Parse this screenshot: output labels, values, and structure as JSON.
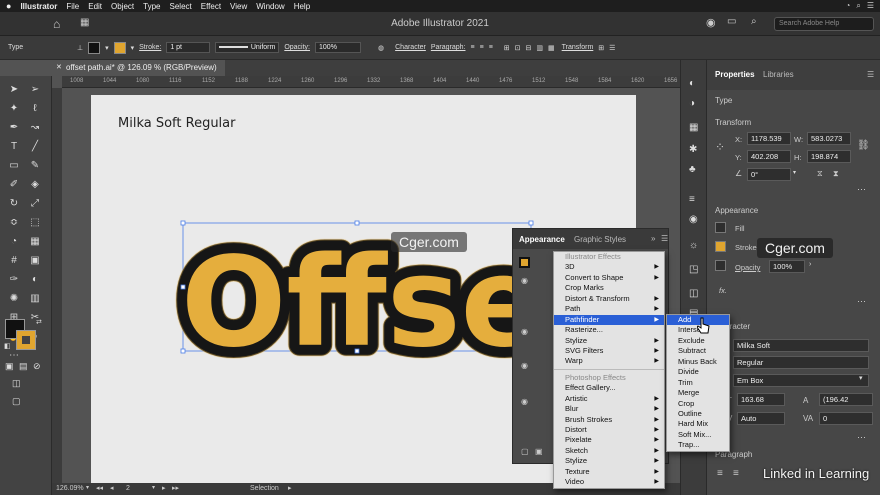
{
  "menubar": {
    "app": "Illustrator",
    "items": [
      "File",
      "Edit",
      "Object",
      "Type",
      "Select",
      "Effect",
      "View",
      "Window",
      "Help"
    ]
  },
  "appbar": {
    "title": "Adobe Illustrator 2021",
    "search_placeholder": "Search Adobe Help"
  },
  "control": {
    "selection_type": "Type",
    "stroke_label": "Stroke:",
    "stroke_weight": "1 pt",
    "profile": "Uniform",
    "opacity_label": "Opacity:",
    "opacity": "100%",
    "character": "Character",
    "paragraph": "Paragraph:",
    "transform": "Transform",
    "fill_color": "#111111",
    "stroke_color": "#e0a52f"
  },
  "document": {
    "tab": "offset path.ai* @ 126.09 % (RGB/Preview)",
    "ruler": [
      "1008",
      "1044",
      "1080",
      "1116",
      "1152",
      "1188",
      "1224",
      "1260",
      "1296",
      "1332",
      "1368",
      "1404",
      "1440",
      "1476",
      "1512",
      "1548",
      "1584",
      "1620",
      "1656"
    ],
    "font_label": "Milka Soft Regular",
    "art_text": "Offset",
    "art_fill": "#e5ae3d",
    "art_outline": "#161616"
  },
  "status": {
    "zoom": "126.09%",
    "page": "2",
    "tool": "Selection"
  },
  "properties": {
    "tab_properties": "Properties",
    "tab_libraries": "Libraries",
    "type_header": "Type",
    "transform_header": "Transform",
    "x_label": "X:",
    "x": "1178.539",
    "y_label": "Y:",
    "y": "402.208",
    "w_label": "W:",
    "w": "583.0273",
    "h_label": "H:",
    "h": "198.874",
    "rotate": "0°",
    "appearance_header": "Appearance",
    "fill_label": "Fill",
    "stroke_label": "Stroke",
    "opacity_label": "Opacity",
    "opacity": "100%",
    "fx": "fx.",
    "character_header": "Character",
    "font": "Milka Soft",
    "style": "Regular",
    "em_box": "Em Box",
    "size": "163.68",
    "leading": "(196.42",
    "kerning": "Auto",
    "tracking": "0",
    "paragraph_header": "Paragraph"
  },
  "appearance_panel": {
    "tab_appearance": "Appearance",
    "tab_graphic_styles": "Graphic Styles"
  },
  "effect_menu": {
    "illustrator_header": "Illustrator Effects",
    "illustrator_items": [
      "3D",
      "Convert to Shape",
      "Crop Marks",
      "Distort & Transform",
      "Path",
      "Pathfinder",
      "Rasterize...",
      "Stylize",
      "SVG Filters",
      "Warp"
    ],
    "photoshop_header": "Photoshop Effects",
    "photoshop_items": [
      "Effect Gallery...",
      "Artistic",
      "Blur",
      "Brush Strokes",
      "Distort",
      "Pixelate",
      "Sketch",
      "Stylize",
      "Texture",
      "Video"
    ]
  },
  "pathfinder_menu": {
    "items": [
      "Add",
      "Intersect",
      "Exclude",
      "Subtract",
      "Minus Back",
      "Divide",
      "Trim",
      "Merge",
      "Crop",
      "Outline",
      "Hard Mix",
      "Soft Mix...",
      "Trap..."
    ]
  },
  "watermarks": {
    "left": "Cger.com",
    "right": "Cger.com",
    "brand": "Linked in Learning"
  }
}
